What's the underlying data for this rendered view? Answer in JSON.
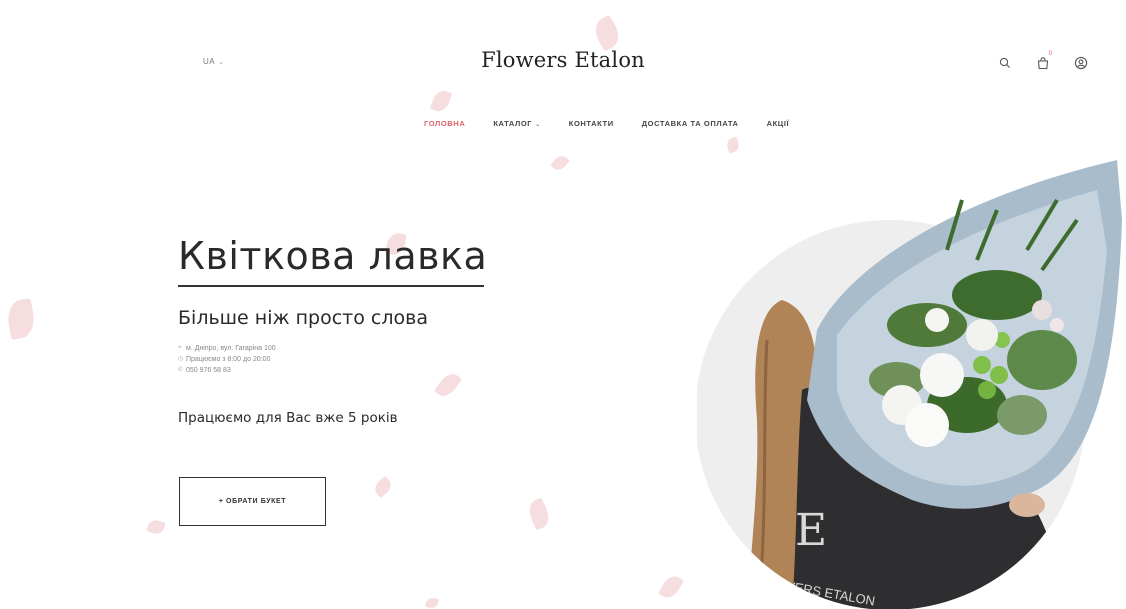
{
  "header": {
    "language": "UA",
    "logo": "Flowers Etalon",
    "cart_count": "0"
  },
  "nav": {
    "items": [
      {
        "label": "ГОЛОВНА",
        "active": true
      },
      {
        "label": "КАТАЛОГ",
        "dropdown": true
      },
      {
        "label": "КОНТАКТИ"
      },
      {
        "label": "ДОСТАВКА ТА ОПЛАТА"
      },
      {
        "label": "АКЦІЇ"
      }
    ]
  },
  "hero": {
    "title": "Квіткова лавка",
    "subtitle": "Більше ніж просто слова",
    "address": "м. Дніпро, вул. Гагаріна 100",
    "hours": "Працюємо з 8:00 до 20:00",
    "phone": "050 976 58 83",
    "years_text": "Працюємо для Вас вже 5 років",
    "cta_label": "+ ОБРАТИ БУКЕТ"
  },
  "photo": {
    "jacket_letter": "E",
    "jacket_text": "FLOWERS ETALON"
  },
  "icons": {
    "search": "search-icon",
    "cart": "cart-icon",
    "account": "user-icon"
  },
  "colors": {
    "accent": "#e2626a",
    "petal": "#f3d3d6",
    "wrap_paper": "#a9bccb",
    "text": "#2a2a2a"
  }
}
